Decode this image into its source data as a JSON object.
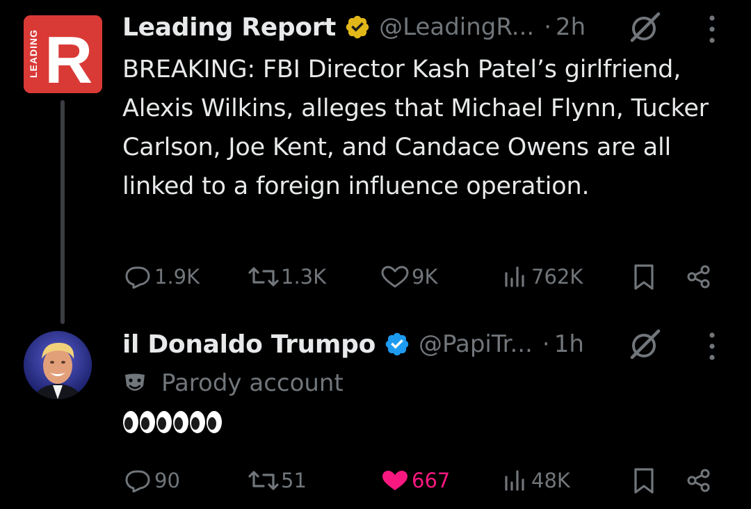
{
  "colors": {
    "background": "#000000",
    "text_primary": "#e7e9ea",
    "text_secondary": "#71767b",
    "like_active": "#f91880",
    "verified_gold": "#e2b719",
    "verified_blue": "#1d9bf0",
    "brand_red": "#d93a36"
  },
  "tweets": [
    {
      "avatar_logo_word": "LEADING",
      "avatar_logo_letter": "R",
      "display_name": "Leading Report",
      "badge": "verified-gold-badge-icon",
      "handle": "@LeadingR...",
      "separator": "·",
      "time": "2h",
      "text": "BREAKING: FBI Director Kash Patel’s girlfriend, Alexis Wilkins, alleges that Michael Flynn, Tucker Carlson, Joe Kent, and Candace Owens are all linked to a foreign influence operation.",
      "stats": {
        "replies": "1.9K",
        "reposts": "1.3K",
        "likes": "9K",
        "views": "762K"
      }
    },
    {
      "display_name": "il Donaldo Trumpo",
      "badge": "verified-blue-badge-icon",
      "handle": "@PapiTr...",
      "separator": "·",
      "time": "1h",
      "parody_label": "Parody account",
      "text_emoji": "eyes-emoji x6",
      "stats": {
        "replies": "90",
        "reposts": "51",
        "likes": "667",
        "views": "48K"
      },
      "liked": true
    }
  ]
}
